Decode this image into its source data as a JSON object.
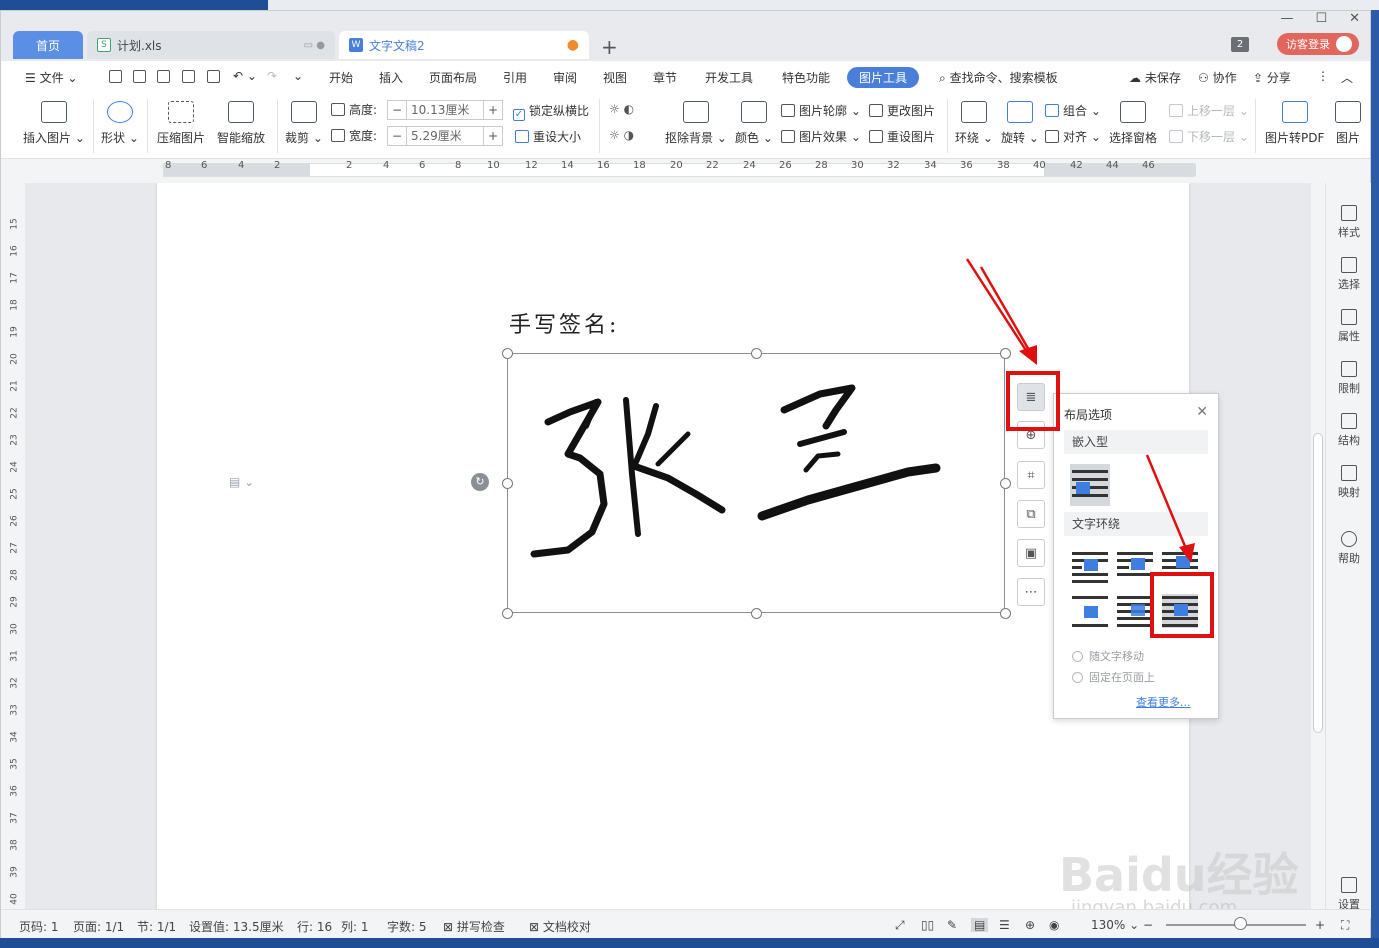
{
  "tabs": {
    "home": "首页",
    "xls": "计划.xls",
    "doc": "文字文稿2",
    "count_badge": "2",
    "visitor_login": "访客登录"
  },
  "menu": {
    "file": "文件",
    "items": [
      "开始",
      "插入",
      "页面布局",
      "引用",
      "审阅",
      "视图",
      "章节",
      "开发工具",
      "特色功能",
      "图片工具"
    ],
    "active": "图片工具",
    "search": "查找命令、搜索模板",
    "unsaved": "未保存",
    "collab": "协作",
    "share": "分享"
  },
  "ribbon": {
    "insert_picture": "插入图片",
    "shape": "形状",
    "compress": "压缩图片",
    "smart_zoom": "智能缩放",
    "crop": "裁剪",
    "height_label": "高度:",
    "height_value": "10.13厘米",
    "width_label": "宽度:",
    "width_value": "5.29厘米",
    "lock_ratio": "锁定纵横比",
    "reset_size": "重设大小",
    "remove_bg": "抠除背景",
    "color": "颜色",
    "outline": "图片轮廓",
    "effects": "图片效果",
    "change_pic": "更改图片",
    "reset_pic": "重设图片",
    "wrap": "环绕",
    "rotate": "旋转",
    "group": "组合",
    "align": "对齐",
    "selection_pane": "选择窗格",
    "bring_forward": "上移一层",
    "send_backward": "下移一层",
    "to_pdf": "图片转PDF",
    "pic_more": "图片"
  },
  "ruler_numbers": [
    "8",
    "6",
    "4",
    "2",
    "2",
    "4",
    "6",
    "8",
    "10",
    "12",
    "14",
    "16",
    "18",
    "20",
    "22",
    "24",
    "26",
    "28",
    "30",
    "32",
    "34",
    "36",
    "38",
    "40",
    "42",
    "44",
    "46"
  ],
  "vruler_numbers": [
    "15",
    "16",
    "17",
    "18",
    "19",
    "20",
    "21",
    "22",
    "23",
    "24",
    "25",
    "26",
    "27",
    "28",
    "29",
    "30",
    "31",
    "32",
    "33",
    "34",
    "35",
    "36",
    "37",
    "38",
    "39",
    "40"
  ],
  "document": {
    "label": "手写签名:",
    "signature_text": "张 三"
  },
  "layout_panel": {
    "title": "布局选项",
    "inline_section": "嵌入型",
    "wrap_section": "文字环绕",
    "move_with_text": "随文字移动",
    "fix_on_page": "固定在页面上",
    "see_more": "查看更多..."
  },
  "sidebar": [
    "样式",
    "选择",
    "属性",
    "限制",
    "结构",
    "映射",
    "帮助",
    "设置"
  ],
  "status": {
    "page_no": "页码: 1",
    "pages": "页面: 1/1",
    "section": "节: 1/1",
    "setting": "设置值: 13.5厘米",
    "row": "行: 16",
    "col": "列: 1",
    "words": "字数: 5",
    "spell": "拼写检查",
    "proof": "文档校对",
    "zoom": "130%"
  },
  "watermark": {
    "main": "Baidu经验",
    "sub": "jingyan.baidu.com"
  },
  "colors": {
    "accent": "#4a7fd9",
    "annotation": "#e01010",
    "login": "#e2665d"
  }
}
